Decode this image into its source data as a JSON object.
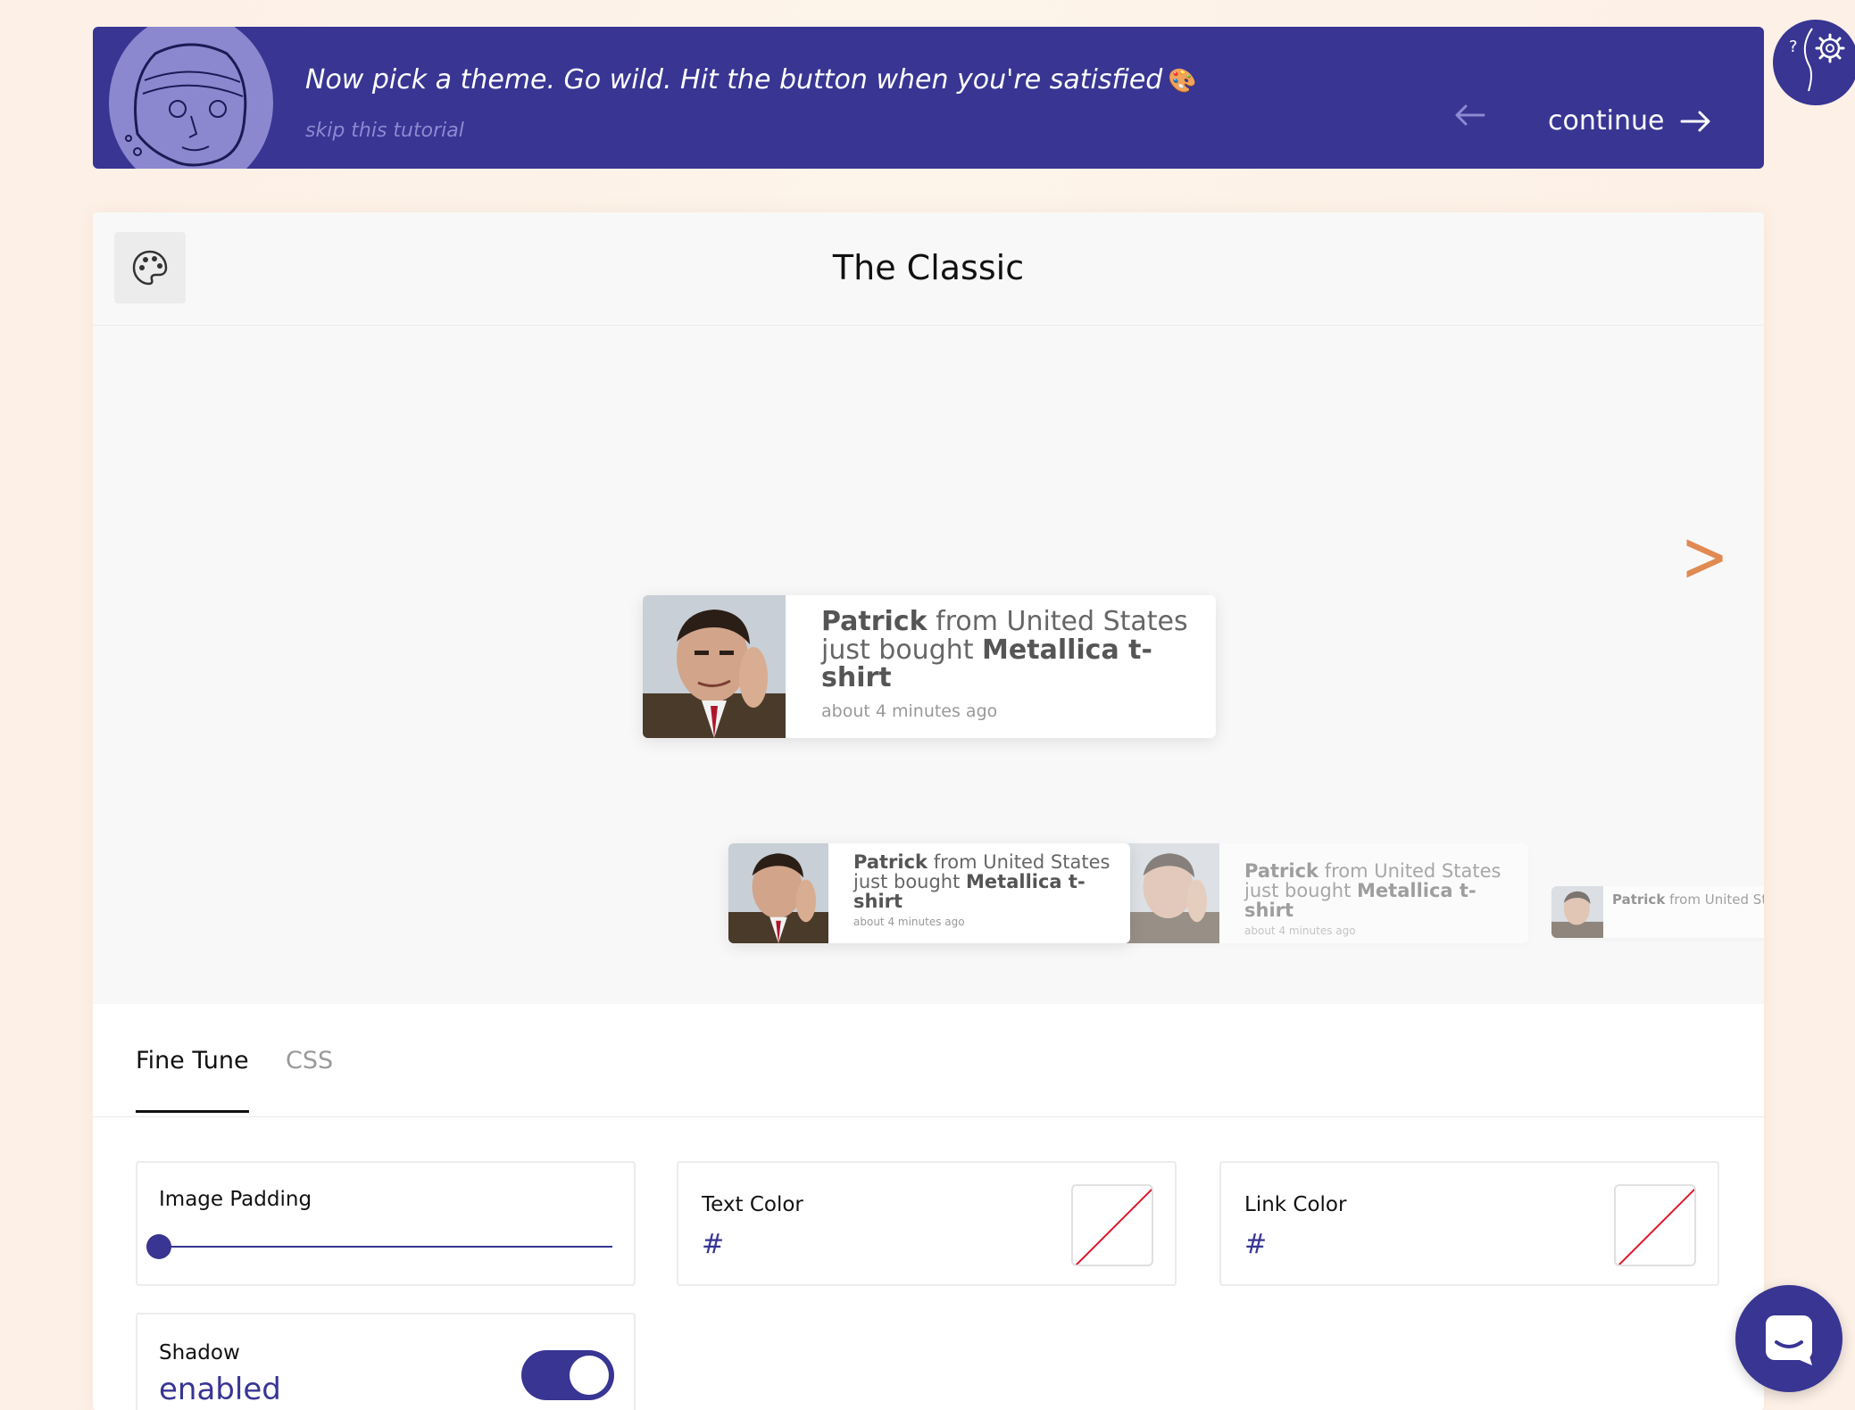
{
  "banner": {
    "title": "Now pick a theme. Go wild. Hit the button when you're satisfied",
    "emoji": "🎨",
    "skip": "skip this tutorial",
    "continue": "continue"
  },
  "icons": {
    "help": "help-gear-icon",
    "theme": "palette-icon",
    "back": "arrow-left-icon",
    "forward": "arrow-right-icon",
    "next": "chevron-right-icon",
    "chat": "chat-icon"
  },
  "colors": {
    "brand": "#383593",
    "accent_arrow": "#e08a52",
    "skip_link": "#8d89d2"
  },
  "theme": {
    "title": "The Classic",
    "next_glyph": ">"
  },
  "notification": {
    "name": "Patrick",
    "location_text": " from United States just bought ",
    "product": "Metallica t-shirt",
    "time": "about 4 minutes ago"
  },
  "tabs": {
    "fine_tune": "Fine Tune",
    "css": "CSS"
  },
  "settings": {
    "image_padding": {
      "label": "Image Padding",
      "value_fraction": 0
    },
    "text_color": {
      "label": "Text Color",
      "prefix": "#",
      "value": ""
    },
    "link_color": {
      "label": "Link Color",
      "prefix": "#",
      "value": ""
    },
    "shadow": {
      "label": "Shadow",
      "state": "enabled"
    }
  }
}
